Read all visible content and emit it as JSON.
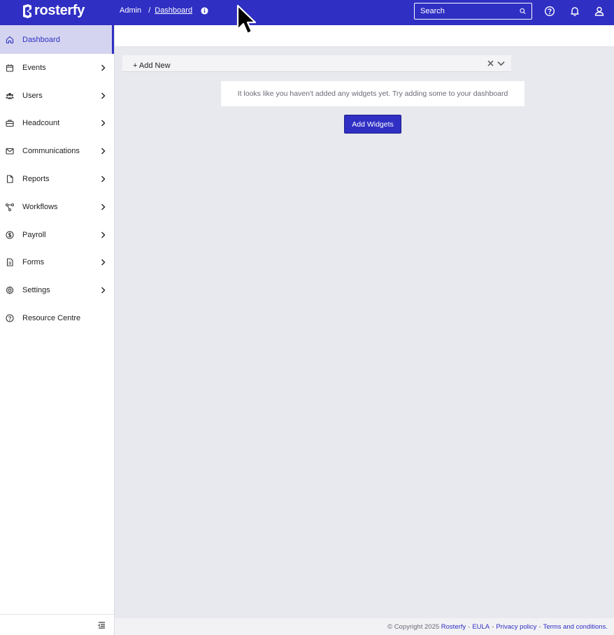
{
  "app": {
    "logo_text": "rosterfy",
    "brand_color": "#2f2fc4"
  },
  "breadcrumb": {
    "root": "Admin",
    "separator": "/",
    "current": "Dashboard"
  },
  "search": {
    "placeholder": "Search"
  },
  "header_icons": [
    "help-icon",
    "bell-icon",
    "user-icon"
  ],
  "sidebar": {
    "items": [
      {
        "label": "Dashboard",
        "icon": "home-icon",
        "active": true,
        "has_children": false
      },
      {
        "label": "Events",
        "icon": "calendar-icon",
        "has_children": true
      },
      {
        "label": "Users",
        "icon": "users-icon",
        "has_children": true
      },
      {
        "label": "Headcount",
        "icon": "briefcase-icon",
        "has_children": true
      },
      {
        "label": "Communications",
        "icon": "envelope-icon",
        "has_children": true
      },
      {
        "label": "Reports",
        "icon": "document-icon",
        "has_children": true
      },
      {
        "label": "Workflows",
        "icon": "workflow-icon",
        "has_children": true
      },
      {
        "label": "Payroll",
        "icon": "dollar-icon",
        "has_children": true
      },
      {
        "label": "Forms",
        "icon": "form-icon",
        "has_children": true
      },
      {
        "label": "Settings",
        "icon": "gear-icon",
        "has_children": true
      },
      {
        "label": "Resource Centre",
        "icon": "question-icon",
        "has_children": false
      }
    ]
  },
  "dashboard": {
    "add_new_label": "+ Add New",
    "empty_message": "It looks like you haven't added any widgets yet. Try adding some to your dashboard",
    "add_widgets_button": "Add Widgets"
  },
  "footer": {
    "copyright": "© Copyright 2025",
    "brand_link": "Rosterfy",
    "eula": "EULA",
    "privacy": "Privacy policy",
    "terms": "Terms and conditions.",
    "separator": "-"
  }
}
